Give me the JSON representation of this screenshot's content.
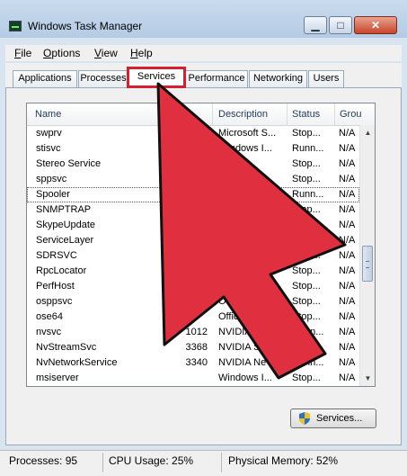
{
  "window": {
    "title": "Windows Task Manager"
  },
  "menu": [
    {
      "label": "File",
      "accel": "F",
      "rest": "ile"
    },
    {
      "label": "Options",
      "accel": "O",
      "rest": "ptions"
    },
    {
      "label": "View",
      "accel": "V",
      "rest": "iew"
    },
    {
      "label": "Help",
      "accel": "H",
      "rest": "elp"
    }
  ],
  "tabs": [
    {
      "label": "Applications"
    },
    {
      "label": "Processes"
    },
    {
      "label": "Services",
      "active": true
    },
    {
      "label": "Performance"
    },
    {
      "label": "Networking"
    },
    {
      "label": "Users"
    }
  ],
  "columns": {
    "name": "Name",
    "description": "Description",
    "status": "Status",
    "group": "Grou"
  },
  "rows": [
    {
      "name": "swprv",
      "pid": "",
      "description": "Microsoft S...",
      "status": "Stop...",
      "group": "N/A"
    },
    {
      "name": "stisvc",
      "pid": "",
      "description": "Windows I...",
      "status": "Runn...",
      "group": "N/A"
    },
    {
      "name": "Stereo Service",
      "pid": "",
      "description": "...e",
      "status": "Stop...",
      "group": "N/A"
    },
    {
      "name": "sppsvc",
      "pid": "",
      "description": "",
      "status": "Stop...",
      "group": "N/A"
    },
    {
      "name": "Spooler",
      "pid": "",
      "description": "",
      "status": "Runn...",
      "group": "N/A",
      "selected": true
    },
    {
      "name": "SNMPTRAP",
      "pid": "",
      "description": "",
      "status": "Stop...",
      "group": "N/A"
    },
    {
      "name": "SkypeUpdate",
      "pid": "",
      "description": "",
      "status": "Stop...",
      "group": "N/A"
    },
    {
      "name": "ServiceLayer",
      "pid": "",
      "description": "",
      "status": "Stop...",
      "group": "N/A"
    },
    {
      "name": "SDRSVC",
      "pid": "",
      "description": "",
      "status": "Stop...",
      "group": "N/A"
    },
    {
      "name": "RpcLocator",
      "pid": "",
      "description": "",
      "status": "Stop...",
      "group": "N/A"
    },
    {
      "name": "PerfHost",
      "pid": "",
      "description": "Pe",
      "status": "Stop...",
      "group": "N/A"
    },
    {
      "name": "osppsvc",
      "pid": "",
      "description": "Office",
      "status": "Stop...",
      "group": "N/A"
    },
    {
      "name": "ose64",
      "pid": "",
      "description": "Office",
      "status": "Stop...",
      "group": "N/A"
    },
    {
      "name": "nvsvc",
      "pid": "1012",
      "description": "NVIDIA",
      "status": "Runn...",
      "group": "N/A"
    },
    {
      "name": "NvStreamSvc",
      "pid": "3368",
      "description": "NVIDIA S",
      "status": "Runn...",
      "group": "N/A"
    },
    {
      "name": "NvNetworkService",
      "pid": "3340",
      "description": "NVIDIA Ne",
      "status": "Runn...",
      "group": "N/A"
    },
    {
      "name": "msiserver",
      "pid": "",
      "description": "Windows I...",
      "status": "Stop...",
      "group": "N/A"
    }
  ],
  "services_button": {
    "label": "Services..."
  },
  "status_bar": {
    "processes": "Processes: 95",
    "cpu": "CPU Usage: 25%",
    "memory": "Physical Memory: 52%"
  },
  "colors": {
    "highlight": "#d6202f",
    "arrow": "#e03040",
    "arrow_outline": "#101010"
  },
  "icons": [
    "task-manager-icon",
    "minimize-icon",
    "maximize-icon",
    "close-icon",
    "shield-icon",
    "pointer-arrow-icon"
  ]
}
